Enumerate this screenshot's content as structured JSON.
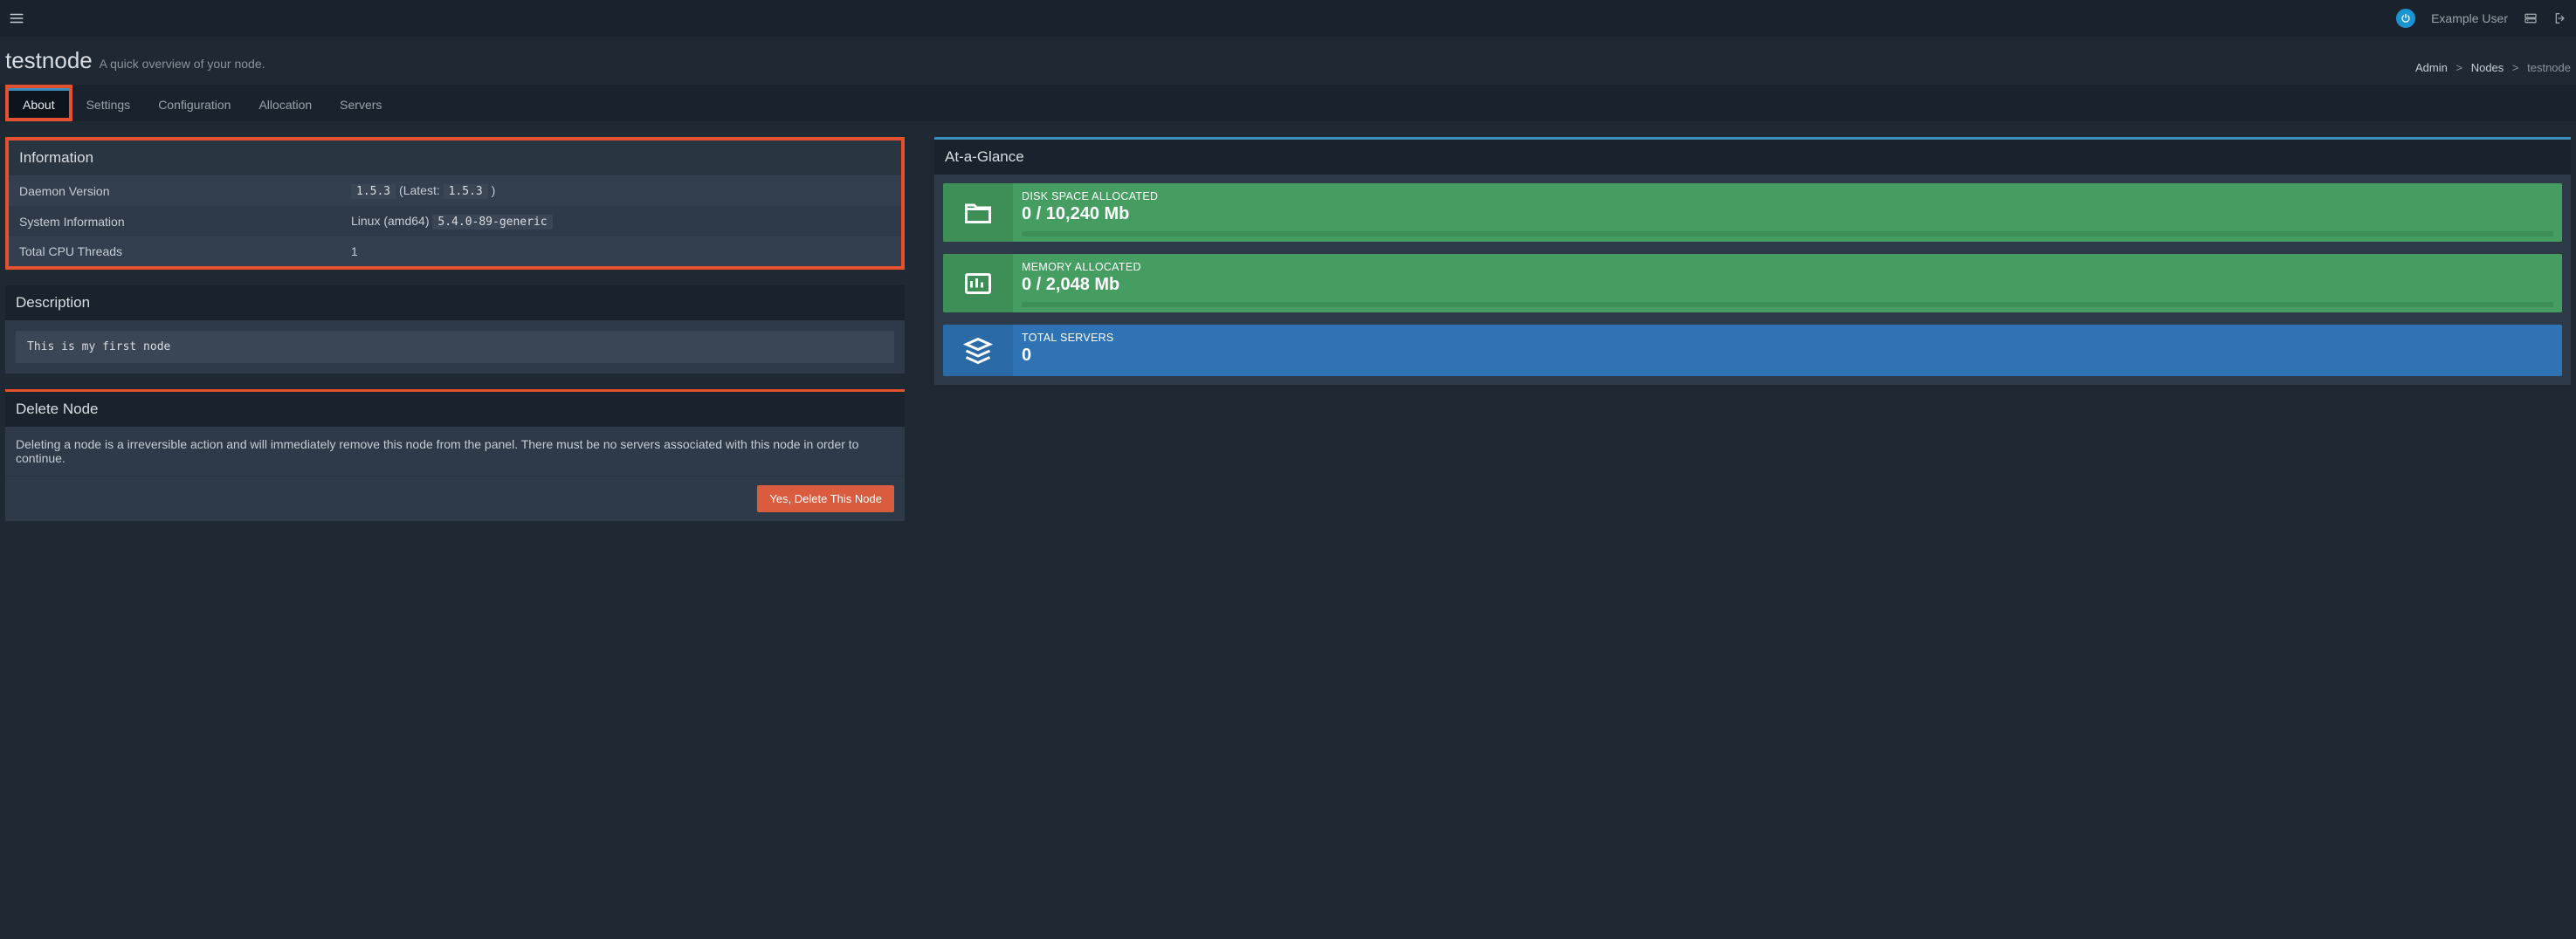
{
  "header": {
    "username": "Example User"
  },
  "page": {
    "title": "testnode",
    "subtitle": "A quick overview of your node."
  },
  "breadcrumb": {
    "items": [
      "Admin",
      "Nodes",
      "testnode"
    ]
  },
  "tabs": [
    {
      "label": "About",
      "active": true
    },
    {
      "label": "Settings",
      "active": false
    },
    {
      "label": "Configuration",
      "active": false
    },
    {
      "label": "Allocation",
      "active": false
    },
    {
      "label": "Servers",
      "active": false
    }
  ],
  "information": {
    "title": "Information",
    "rows": {
      "daemon_version_label": "Daemon Version",
      "daemon_version_value": "1.5.3",
      "daemon_version_latest_prefix": " (Latest: ",
      "daemon_version_latest": "1.5.3",
      "daemon_version_latest_suffix": " )",
      "system_info_label": "System Information",
      "system_info_text": "Linux (amd64) ",
      "system_info_kernel": "5.4.0-89-generic",
      "cpu_label": "Total CPU Threads",
      "cpu_value": "1"
    }
  },
  "description": {
    "title": "Description",
    "body": "This is my first node"
  },
  "delete_panel": {
    "title": "Delete Node",
    "body": "Deleting a node is a irreversible action and will immediately remove this node from the panel. There must be no servers associated with this node in order to continue.",
    "button": "Yes, Delete This Node"
  },
  "glance": {
    "title": "At-a-Glance",
    "disk": {
      "label": "DISK SPACE ALLOCATED",
      "value": "0 / 10,240 Mb"
    },
    "memory": {
      "label": "MEMORY ALLOCATED",
      "value": "0 / 2,048 Mb"
    },
    "servers": {
      "label": "TOTAL SERVERS",
      "value": "0"
    }
  }
}
